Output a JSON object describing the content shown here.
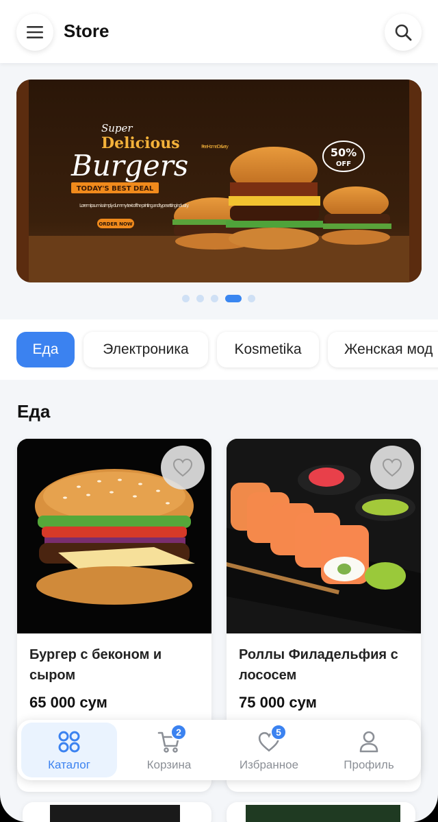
{
  "header": {
    "title": "Store"
  },
  "banner": {
    "super": "Super",
    "headline_1": "Delicious",
    "headline_2": "Burgers",
    "ribbon": "TODAY'S BEST DEAL",
    "body": "Lorem Ipsum is simply dummy text of the printing and typesetting industry.",
    "cta": "ORDER NOW",
    "free_delivery": "Free Home Delivery",
    "discount": "50%",
    "discount_sub": "OFF",
    "slide_count": 5,
    "active_slide": 4
  },
  "categories": [
    "Еда",
    "Электроника",
    "Kosmetika",
    "Женская мод"
  ],
  "section": {
    "title": "Еда"
  },
  "products": [
    {
      "name": "Бургер с беконом и сыром",
      "price": "65 000 сум"
    },
    {
      "name": "Роллы Филадельфия с лососем",
      "price": "75 000 сум"
    }
  ],
  "bottom_nav": [
    {
      "label": "Каталог",
      "icon": "catalog-grid-icon",
      "active": true
    },
    {
      "label": "Корзина",
      "icon": "cart-icon",
      "badge": "2"
    },
    {
      "label": "Избранное",
      "icon": "heart-icon",
      "badge": "5"
    },
    {
      "label": "Профиль",
      "icon": "profile-icon"
    }
  ],
  "colors": {
    "accent": "#3b82f0",
    "background": "#f4f6f9"
  }
}
